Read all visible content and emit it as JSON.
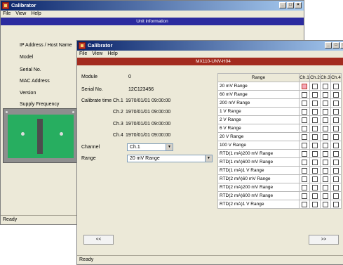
{
  "back": {
    "title": "Calibrator",
    "menu": [
      "File",
      "View",
      "Help"
    ],
    "banner": "Unit information",
    "banner_color": "#2b2b9f",
    "fields": [
      "IP Address / Host Name",
      "Model",
      "Serial No.",
      "MAC Address",
      "Version",
      "Supply Frequency"
    ],
    "status": "Ready"
  },
  "front": {
    "title": "Calibrator",
    "menu": [
      "File",
      "View",
      "Help"
    ],
    "banner": "MX110-UNV-H04",
    "banner_color": "#a32b1f",
    "module_label": "Module",
    "module_value": "0",
    "serial_label": "Serial No.",
    "serial_value": "12C123456",
    "calibrate_label": "Calibrate time",
    "calib": [
      {
        "ch": "Ch.1",
        "time": "1970/01/01 09:00:00"
      },
      {
        "ch": "Ch.2",
        "time": "1970/01/01 09:00:00"
      },
      {
        "ch": "Ch.3",
        "time": "1970/01/01 09:00:00"
      },
      {
        "ch": "Ch.4",
        "time": "1970/01/01 09:00:00"
      }
    ],
    "channel_label": "Channel",
    "channel_value": "Ch.1",
    "range_label": "Range",
    "range_value": "20 mV Range",
    "grid_header": [
      "Range",
      "Ch.1",
      "Ch.2",
      "Ch.3",
      "Ch.4"
    ],
    "ranges": [
      "20 mV Range",
      "60 mV Range",
      "200 mV Range",
      "1 V Range",
      "2 V Range",
      "6 V Range",
      "20 V Range",
      "100 V Range",
      "RTD(1 mA)200 mV Range",
      "RTD(1 mA)600 mV Range",
      "RTD(1 mA)1 V Range",
      "RTD(2 mA)60 mV Range",
      "RTD(2 mA)200 mV Range",
      "RTD(2 mA)600 mV Range",
      "RTD(2 mA)1 V Range"
    ],
    "checked": {
      "row": 0,
      "col": 0
    },
    "prev_label": "<<",
    "next_label": ">>",
    "status": "Ready"
  }
}
